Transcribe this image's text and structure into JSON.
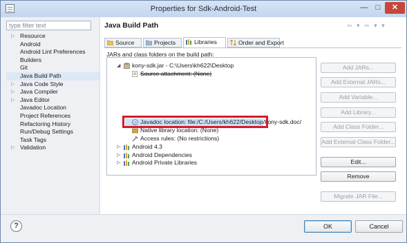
{
  "window": {
    "title": "Properties for Sdk-Android-Test",
    "minimize_glyph": "—",
    "maximize_glyph": "□",
    "close_glyph": "✕"
  },
  "sidebar": {
    "filter_placeholder": "type filter text",
    "items": [
      {
        "label": "Resource",
        "expandable": true
      },
      {
        "label": "Android",
        "expandable": false
      },
      {
        "label": "Android Lint Preferences",
        "expandable": false
      },
      {
        "label": "Builders",
        "expandable": false
      },
      {
        "label": "Git",
        "expandable": false
      },
      {
        "label": "Java Build Path",
        "expandable": false,
        "selected": true
      },
      {
        "label": "Java Code Style",
        "expandable": true
      },
      {
        "label": "Java Compiler",
        "expandable": true
      },
      {
        "label": "Java Editor",
        "expandable": true
      },
      {
        "label": "Javadoc Location",
        "expandable": false
      },
      {
        "label": "Project References",
        "expandable": false
      },
      {
        "label": "Refactoring History",
        "expandable": false
      },
      {
        "label": "Run/Debug Settings",
        "expandable": false
      },
      {
        "label": "Task Tags",
        "expandable": false
      },
      {
        "label": "Validation",
        "expandable": true
      }
    ]
  },
  "main": {
    "title": "Java Build Path",
    "nav_arrows": "⇦ ▾ ⇨ ▾ ▾",
    "tabs": [
      {
        "label": "Source",
        "icon": "source-folder-icon"
      },
      {
        "label": "Projects",
        "icon": "projects-icon"
      },
      {
        "label": "Libraries",
        "icon": "libraries-icon",
        "active": true
      },
      {
        "label": "Order and Export",
        "icon": "order-export-icon"
      }
    ],
    "section_label": "JARs and class folders on the build path:",
    "libraries": {
      "jar_entry": "kony-sdk.jar - C:\\Users\\kh622\\Desktop",
      "source_attachment": "Source attachment: (None)",
      "javadoc_location": "Javadoc location: file:/C:/Users/kh622/Desktop/kony-sdk.doc/",
      "native_library": "Native library location: (None)",
      "access_rules": "Access rules: (No restrictions)",
      "containers": [
        "Android 4.3",
        "Android Dependencies",
        "Android Private Libraries"
      ]
    },
    "buttons": {
      "add_jars": "Add JARs...",
      "add_external_jars": "Add External JARs...",
      "add_variable": "Add Variable...",
      "add_library": "Add Library...",
      "add_class_folder": "Add Class Folder...",
      "add_external_class_folder": "Add External Class Folder...",
      "edit": "Edit...",
      "remove": "Remove",
      "migrate_jar": "Migrate JAR File..."
    }
  },
  "footer": {
    "help_glyph": "?",
    "ok": "OK",
    "cancel": "Cancel"
  },
  "colors": {
    "highlight_box": "#d61a28",
    "selection": "#cfe3f7",
    "close_button": "#c7463a"
  }
}
